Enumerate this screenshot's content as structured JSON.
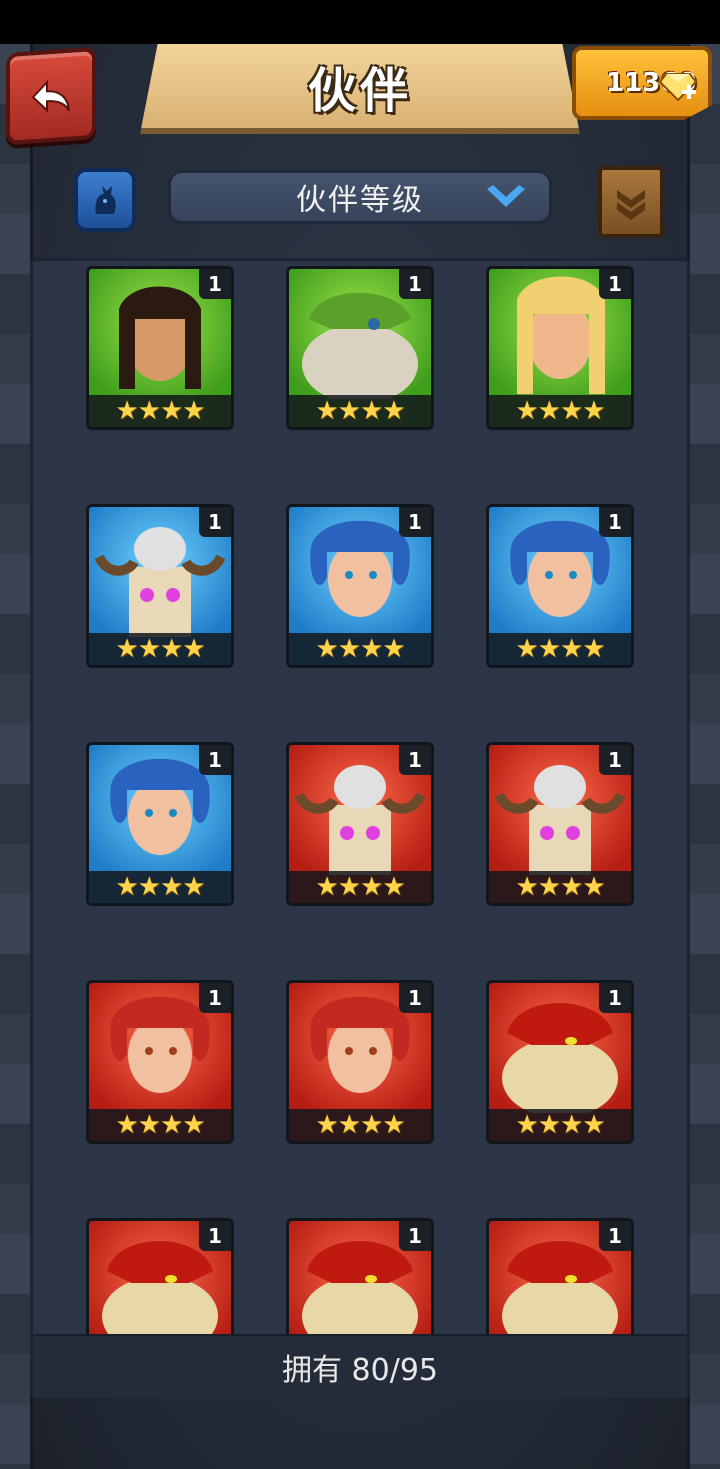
{
  "header": {
    "title": "伙伴",
    "gems": "11360",
    "back_icon": "back-arrow-icon",
    "gem_icon": "diamond-plus-icon"
  },
  "toolbar": {
    "filter_icon": "cat-filter-icon",
    "sort_label": "伙伴等级",
    "dropdown_icon": "chevron-down-icon",
    "scroll_icon": "scroll-chevron-icon"
  },
  "heroes": [
    {
      "level": "1",
      "stars": "★★★★",
      "bg": "green",
      "portrait": "dark-haired-woman"
    },
    {
      "level": "1",
      "stars": "★★★★",
      "bg": "green",
      "portrait": "green-helmet-beast"
    },
    {
      "level": "1",
      "stars": "★★★★",
      "bg": "green",
      "portrait": "blonde-woman"
    },
    {
      "level": "1",
      "stars": "★★★★",
      "bg": "blue",
      "portrait": "skull-totem"
    },
    {
      "level": "1",
      "stars": "★★★★",
      "bg": "blue",
      "portrait": "blue-haired-woman"
    },
    {
      "level": "1",
      "stars": "★★★★",
      "bg": "blue",
      "portrait": "blue-haired-woman"
    },
    {
      "level": "1",
      "stars": "★★★★",
      "bg": "blue",
      "portrait": "blue-haired-woman"
    },
    {
      "level": "1",
      "stars": "★★★★",
      "bg": "red",
      "portrait": "skull-totem"
    },
    {
      "level": "1",
      "stars": "★★★★",
      "bg": "red",
      "portrait": "skull-totem"
    },
    {
      "level": "1",
      "stars": "★★★★",
      "bg": "red",
      "portrait": "red-haired-woman"
    },
    {
      "level": "1",
      "stars": "★★★★",
      "bg": "red",
      "portrait": "red-haired-woman"
    },
    {
      "level": "1",
      "stars": "★★★★",
      "bg": "red",
      "portrait": "red-helmet-beast"
    },
    {
      "level": "1",
      "stars": "★★★★",
      "bg": "red",
      "portrait": "red-helmet-beast"
    },
    {
      "level": "1",
      "stars": "★★★★",
      "bg": "red",
      "portrait": "red-helmet-beast"
    },
    {
      "level": "1",
      "stars": "★★★★",
      "bg": "red",
      "portrait": "red-helmet-beast"
    }
  ],
  "footer": {
    "owned": "拥有 80/95"
  }
}
